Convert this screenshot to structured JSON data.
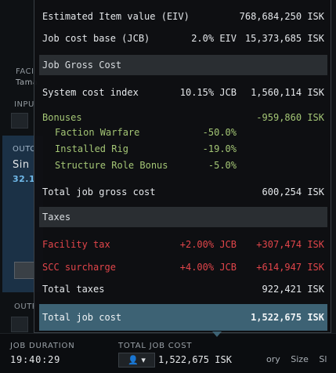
{
  "tooltip": {
    "estimated_item_value": {
      "label": "Estimated Item value (EIV)",
      "value": "768,684,250 ISK"
    },
    "job_cost_base": {
      "label": "Job cost base (JCB)",
      "pct": "2.0% EIV",
      "value": "15,373,685 ISK"
    },
    "gross_header": "Job Gross Cost",
    "system_cost_index": {
      "label": "System cost index",
      "pct": "10.15% JCB",
      "value": "1,560,114 ISK"
    },
    "bonuses": {
      "label": "Bonuses",
      "value": "-959,860 ISK",
      "items": [
        {
          "label": "Faction Warfare",
          "pct": "-50.0%"
        },
        {
          "label": "Installed Rig",
          "pct": "-19.0%"
        },
        {
          "label": "Structure Role Bonus",
          "pct": "-5.0%"
        }
      ]
    },
    "total_job_gross_cost": {
      "label": "Total job gross cost",
      "value": "600,254 ISK"
    },
    "taxes_header": "Taxes",
    "facility_tax": {
      "label": "Facility tax",
      "pct": "+2.00% JCB",
      "value": "+307,474 ISK"
    },
    "scc_surcharge": {
      "label": "SCC surcharge",
      "pct": "+4.00% JCB",
      "value": "+614,947 ISK"
    },
    "total_taxes": {
      "label": "Total taxes",
      "value": "922,421 ISK"
    },
    "total_job_cost": {
      "label": "Total job cost",
      "value": "1,522,675 ISK"
    }
  },
  "background": {
    "facility_label": "FACI",
    "facility_name": "Tama",
    "input_label": "INPU",
    "outcome_label": "OUTC",
    "outcome_name": "Sin",
    "outcome_value": "32.1",
    "output_label": "OUTP",
    "footer": {
      "job_duration_label": "JOB DURATION",
      "job_duration_value": "19:40:29",
      "total_job_cost_label": "TOTAL JOB COST",
      "total_job_cost_value": "1,522,675 ISK",
      "tabs": [
        "ory",
        "Size",
        "Sl"
      ]
    }
  },
  "colors": {
    "bonus_green": "#a4c675",
    "tax_red": "#e1454a",
    "total_bar": "#3d6274",
    "section_header": "#2a2e32"
  }
}
